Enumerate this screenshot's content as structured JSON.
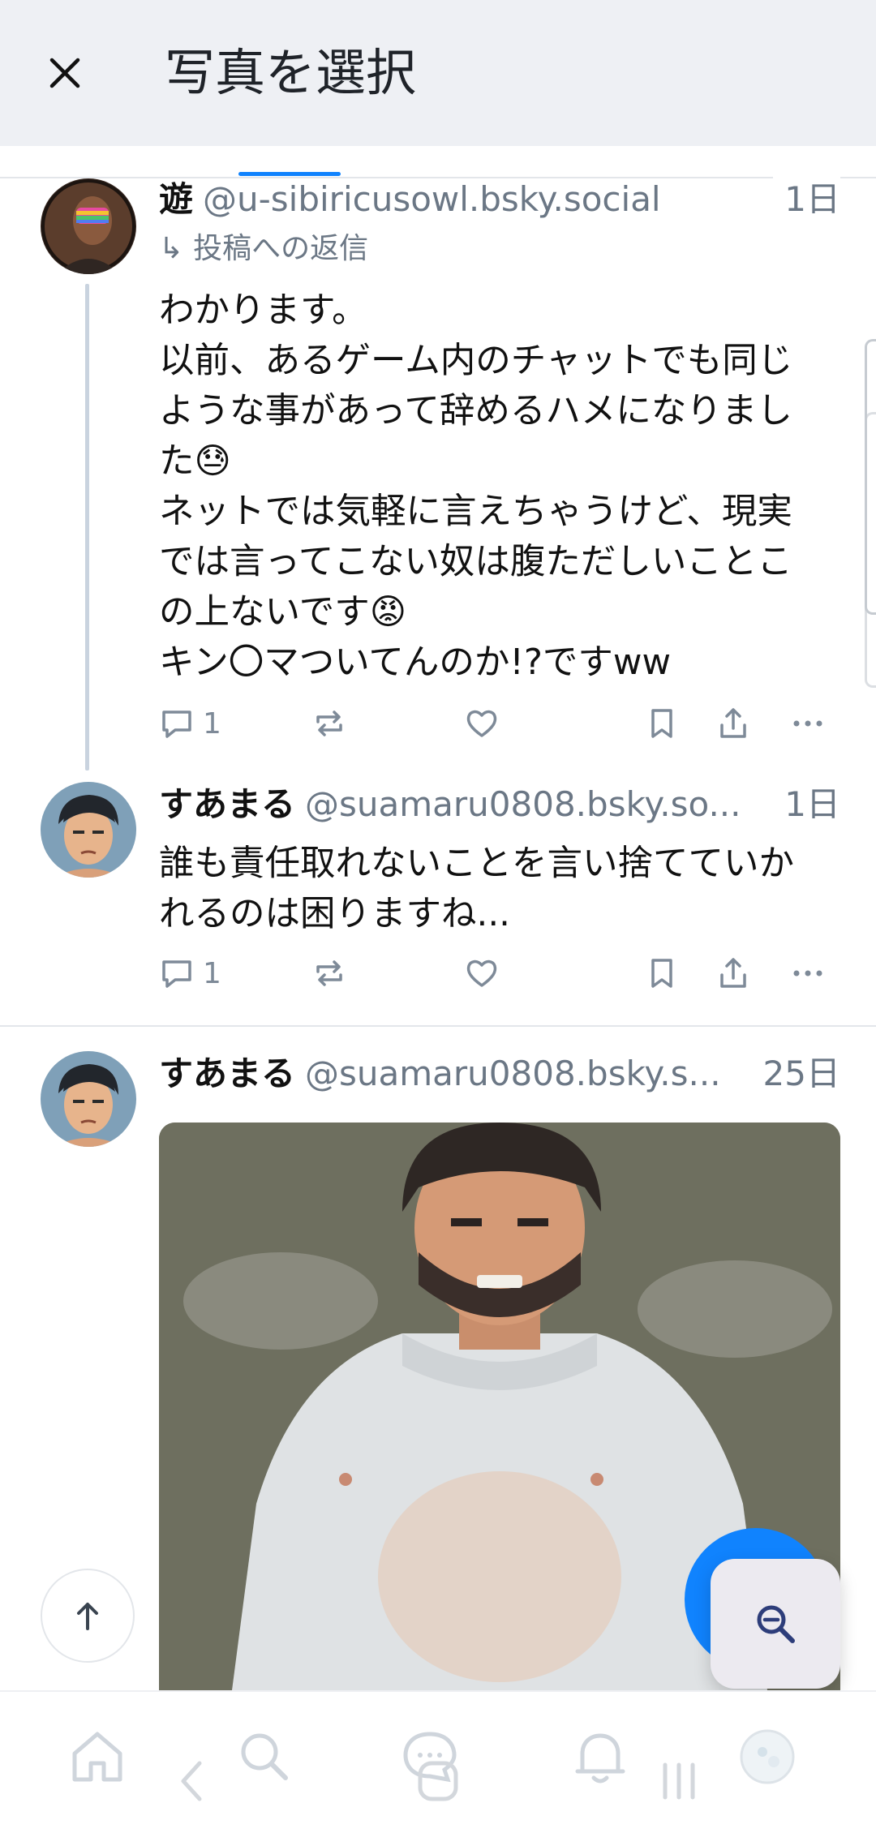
{
  "header": {
    "title": "写真を選択"
  },
  "posts": [
    {
      "author": "遊",
      "handle": "@u-sibiricusowl.bsky.social",
      "time": "1日",
      "reply_to": "投稿への返信",
      "lines": [
        "わかります。",
        "以前、あるゲーム内のチャットでも同じ",
        "ような事があって辞めるハメになりまし",
        "た😓",
        "ネットでは気軽に言えちゃうけど、現実",
        "では言ってこない奴は腹ただしいことこ",
        "の上ないです😡",
        "キン〇マついてんのか!?ですww"
      ],
      "reply_count": "1"
    },
    {
      "author": "すあまる",
      "handle": "@suamaru0808.bsky.so...",
      "time": "1日",
      "lines": [
        "誰も責任取れないことを言い捨てていか",
        "れるのは困りますね..."
      ],
      "reply_count": "1"
    },
    {
      "author": "すあまる",
      "handle": "@suamaru0808.bsky.s...",
      "time": "25日"
    }
  ],
  "icons": {
    "close": "close-icon",
    "reply": "reply-icon",
    "repost": "repost-icon",
    "like": "heart-icon",
    "bookmark": "bookmark-icon",
    "share": "share-icon",
    "more": "more-icon",
    "scroll_top": "arrow-up-icon",
    "zoom": "zoom-out-icon",
    "nav": [
      "home-icon",
      "search-icon",
      "chat-icon",
      "bell-icon",
      "profile-avatar"
    ]
  },
  "colors": {
    "accent": "#1083fe",
    "header_bg": "#eef0f4",
    "muted_text": "#6b7785"
  }
}
